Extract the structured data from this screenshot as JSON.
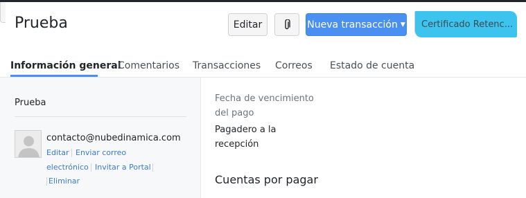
{
  "header": {
    "title": "Prueba",
    "edit_label": "Editar",
    "attach_icon": "paperclip-icon",
    "new_transaction_label": "Nueva transacción",
    "certificate_label": "Certificado Retenc..."
  },
  "tabs": [
    {
      "label": "Información general",
      "active": true
    },
    {
      "label": "Comentarios"
    },
    {
      "label": "Transacciones"
    },
    {
      "label": "Correos"
    },
    {
      "label": "Estado de cuenta"
    }
  ],
  "sidebar": {
    "name": "Prueba",
    "contact": {
      "email": "contacto@nubedinamica.com",
      "actions": {
        "edit": "Editar",
        "send_email_1": "Enviar correo",
        "send_email_2": "electrónico",
        "invite": "Invitar a Portal",
        "delete": "Eliminar"
      }
    }
  },
  "main": {
    "due_date_label_1": "Fecha de vencimiento",
    "due_date_label_2": "del pago",
    "due_date_value_1": "Pagadero a la",
    "due_date_value_2": "recepción",
    "section_title": "Cuentas por pagar"
  },
  "colors": {
    "primary": "#4a90f0",
    "highlight": "#3cc4ef",
    "link": "#3a7bd5"
  }
}
